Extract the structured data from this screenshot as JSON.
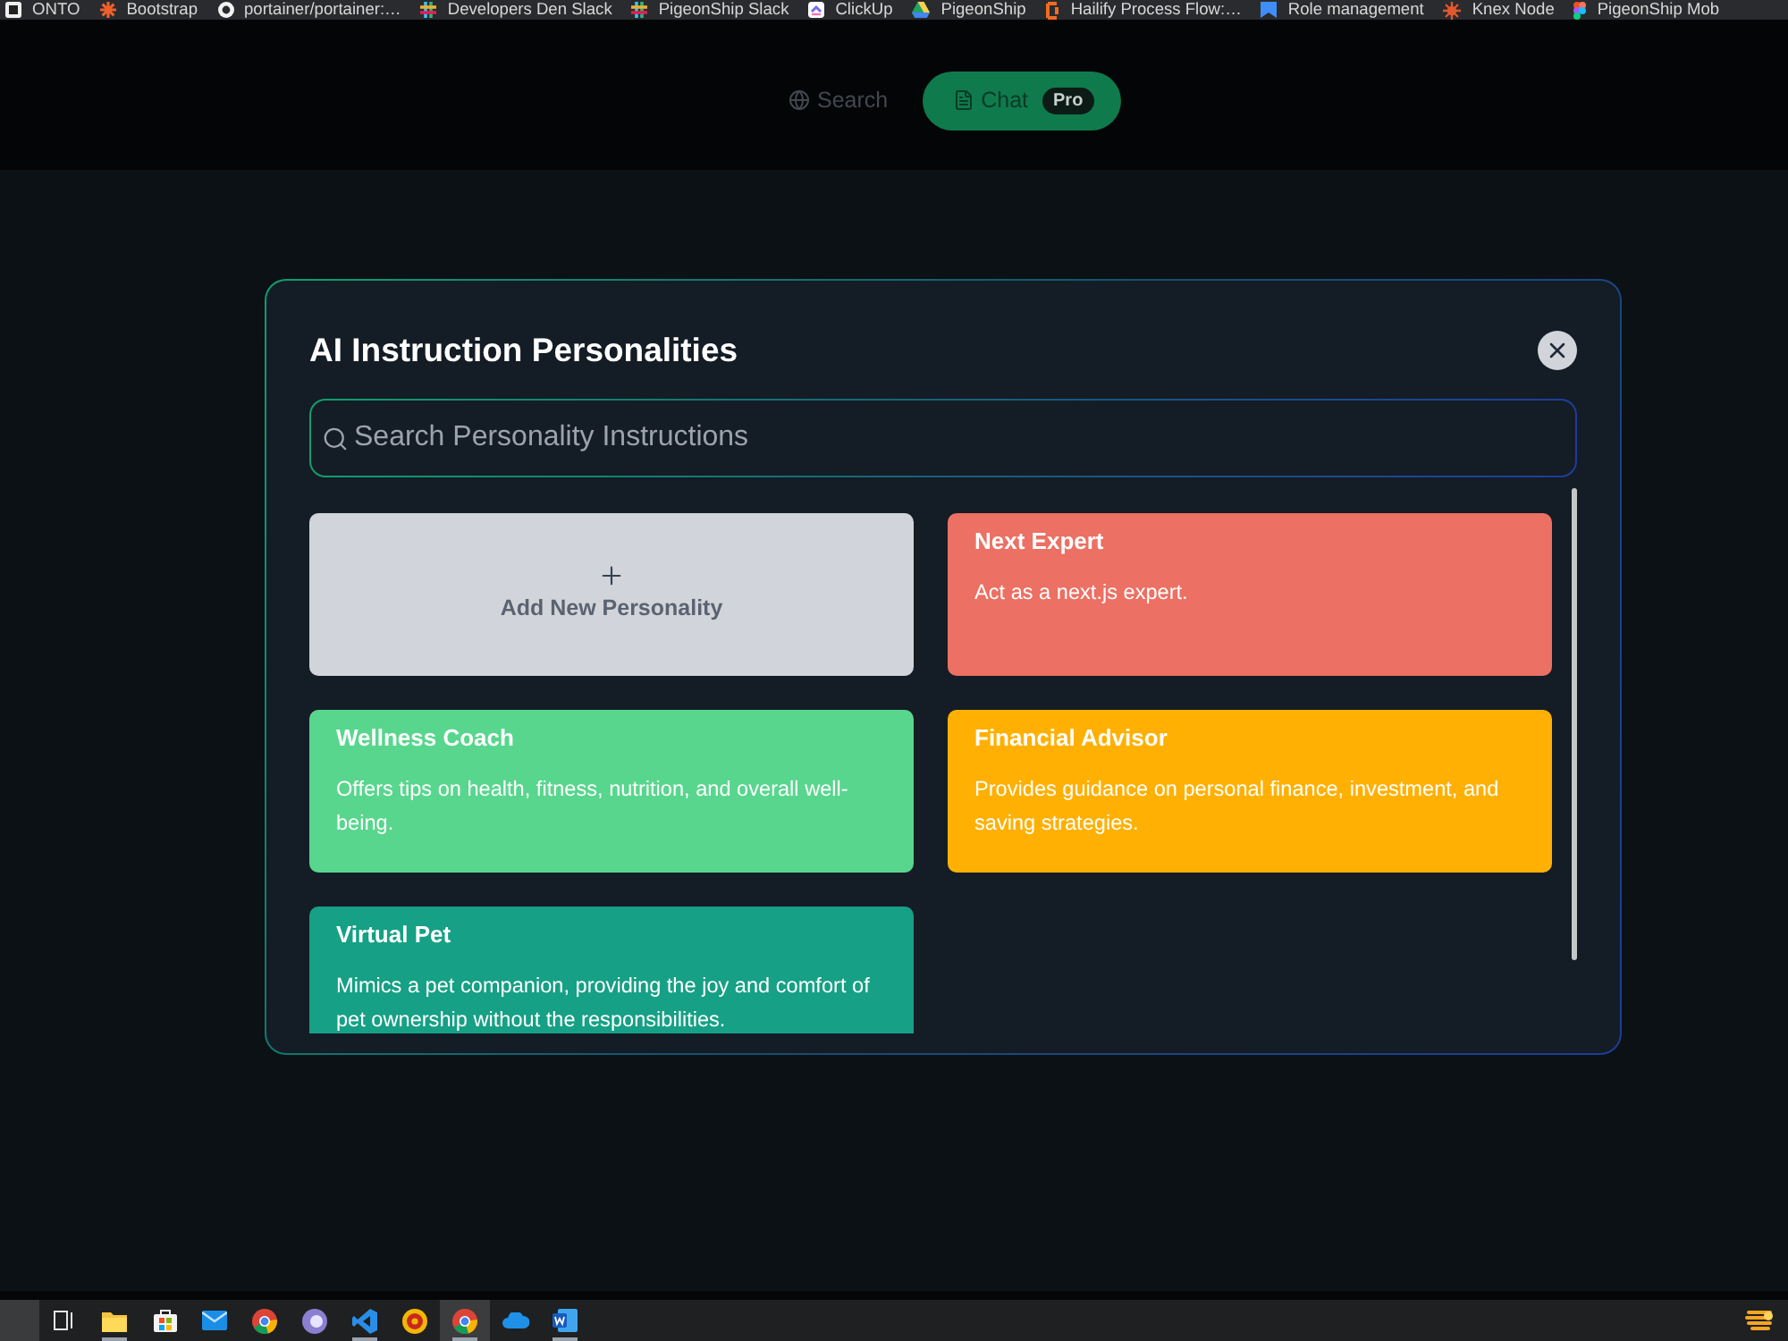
{
  "bookmarks": [
    {
      "label": "ONTO"
    },
    {
      "label": "Bootstrap"
    },
    {
      "label": "portainer/portainer:…"
    },
    {
      "label": "Developers Den Slack"
    },
    {
      "label": "PigeonShip Slack"
    },
    {
      "label": "ClickUp"
    },
    {
      "label": "PigeonShip"
    },
    {
      "label": "Hailify Process Flow:…"
    },
    {
      "label": "Role management"
    },
    {
      "label": "Knex Node"
    },
    {
      "label": "PigeonShip Mob"
    }
  ],
  "nav": {
    "tabs": [
      {
        "label": "Search",
        "selected": false
      },
      {
        "label": "Chat",
        "selected": true,
        "badge": "Pro"
      }
    ]
  },
  "dialog": {
    "title": "AI Instruction Personalities",
    "search": {
      "placeholder": "Search Personality Instructions"
    },
    "add_card": {
      "label": "Add New Personality"
    },
    "personalities": [
      {
        "title": "Next Expert",
        "description": "Act as a next.js expert.",
        "color": "#ec7063"
      },
      {
        "title": "Wellness Coach",
        "description": "Offers tips on health, fitness, nutrition, and overall well-being.",
        "color": "#58d68d"
      },
      {
        "title": "Financial Advisor",
        "description": "Provides guidance on personal finance, investment, and saving strategies.",
        "color": "#ffb003"
      },
      {
        "title": "Virtual Pet",
        "description": "Mimics a pet companion, providing the joy and comfort of pet ownership without the responsibilities.",
        "color": "#16a085"
      }
    ]
  },
  "taskbar": {
    "apps": [
      {
        "open": true,
        "selected": false
      },
      {
        "open": false,
        "selected": false
      },
      {
        "open": false,
        "selected": false
      },
      {
        "open": false,
        "selected": false
      },
      {
        "open": false,
        "selected": false
      },
      {
        "open": true,
        "selected": false
      },
      {
        "open": false,
        "selected": false
      },
      {
        "open": true,
        "selected": true
      },
      {
        "open": false,
        "selected": false
      },
      {
        "open": true,
        "selected": false
      }
    ]
  }
}
